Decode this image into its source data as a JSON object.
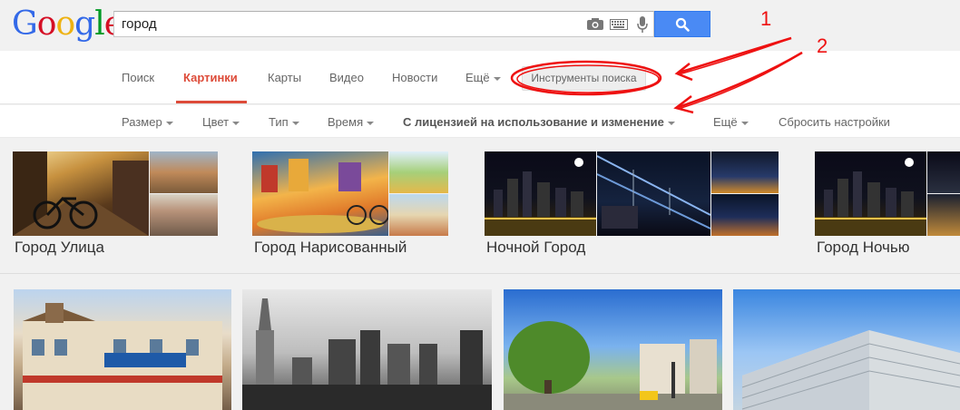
{
  "header": {
    "logo_letters": [
      "G",
      "o",
      "o",
      "g",
      "l",
      "e"
    ],
    "search": {
      "value": "город"
    }
  },
  "tabs": {
    "items": [
      "Поиск",
      "Картинки",
      "Карты",
      "Видео",
      "Новости",
      "Ещё"
    ],
    "active": "Картинки",
    "tools_label": "Инструменты поиска"
  },
  "filters": {
    "items": [
      "Размер",
      "Цвет",
      "Тип",
      "Время",
      "С лицензией на использование и изменение",
      "Ещё",
      "Сбросить настройки"
    ]
  },
  "related": {
    "categories": [
      "Город Улица",
      "Город Нарисованный",
      "Ночной Город",
      "Город Ночью"
    ]
  },
  "annotations": {
    "numbers": [
      "1",
      "2"
    ]
  },
  "colors": {
    "accent": "#dd4b39",
    "search_button": "#4a8af4",
    "annotation": "#ee1111"
  }
}
